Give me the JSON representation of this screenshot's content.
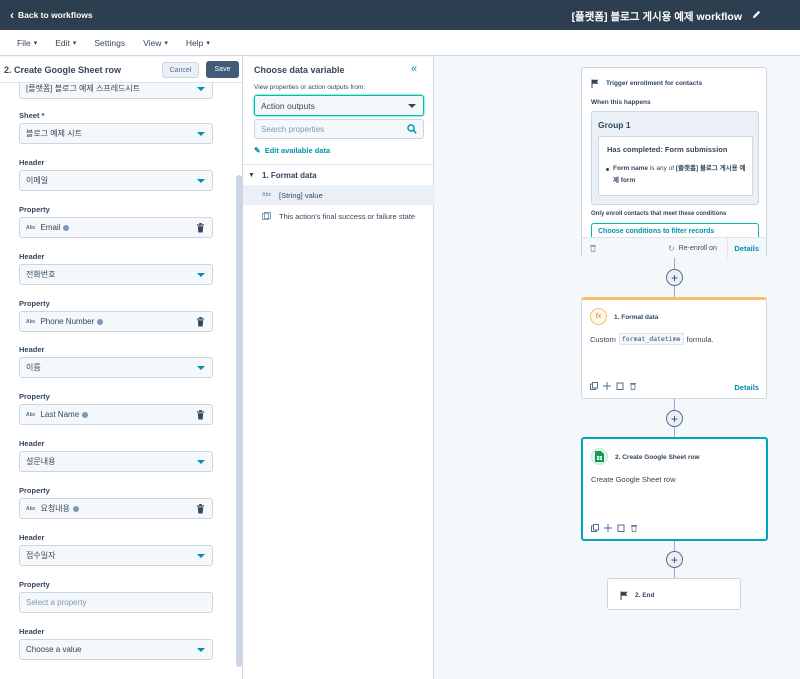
{
  "topbar": {
    "back_label": "Back to workflows",
    "workflow_title": "[플랫폼] 블로그 게시용 예제 workflow"
  },
  "menu": {
    "items": [
      "File",
      "Edit",
      "Settings",
      "View",
      "Help"
    ]
  },
  "left_panel": {
    "title": "2. Create Google Sheet row",
    "cancel_label": "Cancel",
    "save_label": "Save",
    "spreadsheet_value": "[플랫폼] 블로그 예제 스프레드시트",
    "sheet_label": "Sheet *",
    "sheet_value": "블로그 예제 시트",
    "header_label": "Header",
    "property_label": "Property",
    "abc_tag": "Abc",
    "rows": [
      {
        "header": "이메일",
        "property": "Email"
      },
      {
        "header": "전화번호",
        "property": "Phone Number"
      },
      {
        "header": "이름",
        "property": "Last Name"
      },
      {
        "header": "설문내용",
        "property": "요청내용"
      },
      {
        "header": "접수일자",
        "property_placeholder": "Select a property"
      },
      {
        "header_placeholder": "Choose a value"
      }
    ]
  },
  "middle_panel": {
    "title": "Choose data variable",
    "collapse_glyph": "«",
    "source_label": "View properties or action outputs from:",
    "source_value": "Action outputs",
    "search_placeholder": "Search properties",
    "edit_link": "Edit available data",
    "group_title": "1. Format data",
    "variables": [
      {
        "tag": "Abc",
        "label": "[String] value",
        "selected": true
      },
      {
        "tag": "",
        "label": "This action's final success or failure state",
        "selected": false
      }
    ]
  },
  "canvas": {
    "trigger": {
      "heading": "Trigger enrollment for contacts",
      "when": "When this happens",
      "group_title": "Group 1",
      "filter_heading": "Has completed: Form submission",
      "filter_field": "Form name",
      "filter_op": " is any of ",
      "filter_value": "[플랫폼] 블로그 게시용 예제 form",
      "only_enroll": "Only enroll contacts that meet these conditions",
      "choose_conditions": "Choose conditions to filter records",
      "reenroll": "Re-enroll on",
      "details": "Details"
    },
    "plus_glyph": "+",
    "format_action": {
      "title": "1. Format data",
      "desc_prefix": "Custom",
      "desc_code": "format_datetime",
      "desc_suffix": "formula.",
      "details": "Details",
      "icon_glyph": "fx"
    },
    "gsheet_action": {
      "title": "2. Create Google Sheet row",
      "desc": "Create Google Sheet row"
    },
    "end": {
      "label": "2. End"
    }
  },
  "colors": {
    "topbar": "#2d3e50",
    "accent": "#0091ae",
    "focus": "#00bda5",
    "format_accent": "#f5c26b",
    "selected_card": "#00a4bd"
  }
}
